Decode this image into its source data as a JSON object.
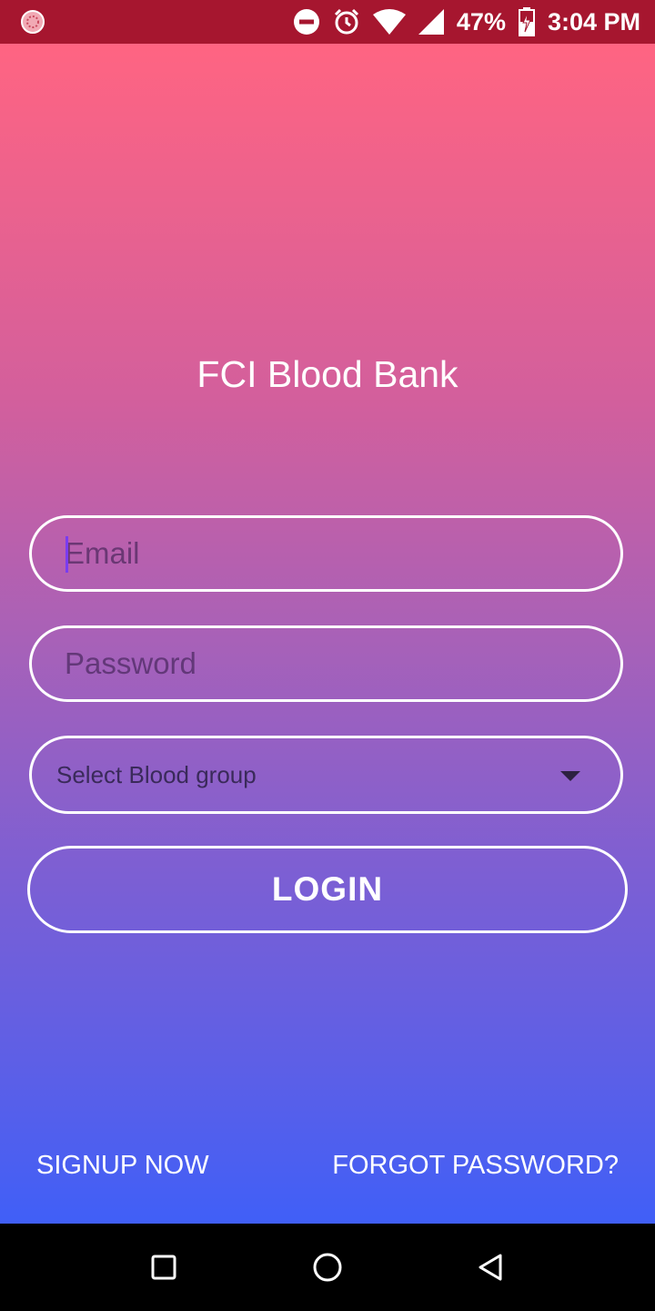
{
  "status_bar": {
    "battery": "47%",
    "time": "3:04 PM",
    "icons": [
      "app-notification-icon",
      "do-not-disturb-icon",
      "alarm-icon",
      "wifi-icon",
      "signal-icon",
      "battery-charging-icon"
    ]
  },
  "app": {
    "title": "FCI Blood Bank"
  },
  "form": {
    "email_placeholder": "Email",
    "password_placeholder": "Password",
    "blood_group_label": "Select Blood group",
    "login_label": "LOGIN"
  },
  "links": {
    "signup": "SIGNUP NOW",
    "forgot": "FORGOT PASSWORD?"
  },
  "nav": {
    "icons": [
      "recent-apps-icon",
      "home-icon",
      "back-icon"
    ]
  },
  "colors": {
    "status_bar": "#a6162f",
    "gradient_top": "#ff6482",
    "gradient_bottom": "#405ff7",
    "caret": "#7a3cf0"
  }
}
